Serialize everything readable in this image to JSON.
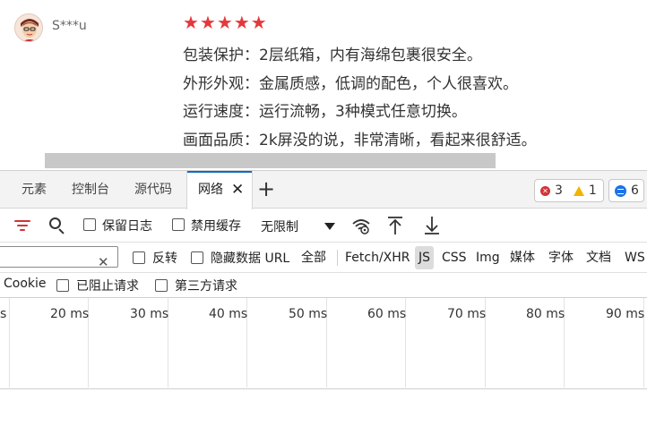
{
  "review": {
    "username": "S***u",
    "rating": 5,
    "lines": [
      "包装保护：2层纸箱，内有海绵包裹很安全。",
      "外形外观：金属质感，低调的配色，个人很喜欢。",
      "运行速度：运行流畅，3种模式任意切换。",
      "画面品质：2k屏没的说，非常清晰，看起来很舒适。"
    ]
  },
  "devtools": {
    "tabs": [
      "元素",
      "控制台",
      "源代码",
      "网络"
    ],
    "active_tab": "网络",
    "add_tab_icon": "plus-icon",
    "badges": {
      "errors": "3",
      "warnings": "1",
      "messages": "6"
    },
    "toolbar": {
      "preserve_log": "保留日志",
      "disable_cache": "禁用缓存",
      "throttling": "无限制"
    },
    "filter": {
      "invert": "反转",
      "hide_data_urls": "隐藏数据 URL",
      "all": "全部",
      "types": [
        "Fetch/XHR",
        "JS",
        "CSS",
        "Img",
        "媒体",
        "字体",
        "文档",
        "WS"
      ],
      "active_type": "JS"
    },
    "filter_row2": {
      "cookie": "Cookie",
      "blocked_requests": "已阻止请求",
      "third_party": "第三方请求"
    },
    "timeline": {
      "ticks": [
        "s",
        "20 ms",
        "30 ms",
        "40 ms",
        "50 ms",
        "60 ms",
        "70 ms",
        "80 ms",
        "90 ms"
      ]
    },
    "colors": {
      "accent": "#0f6cbd",
      "error": "#d13438",
      "warning": "#f2b400",
      "info": "#1a73e8",
      "rating_star": "#e4393c"
    }
  }
}
